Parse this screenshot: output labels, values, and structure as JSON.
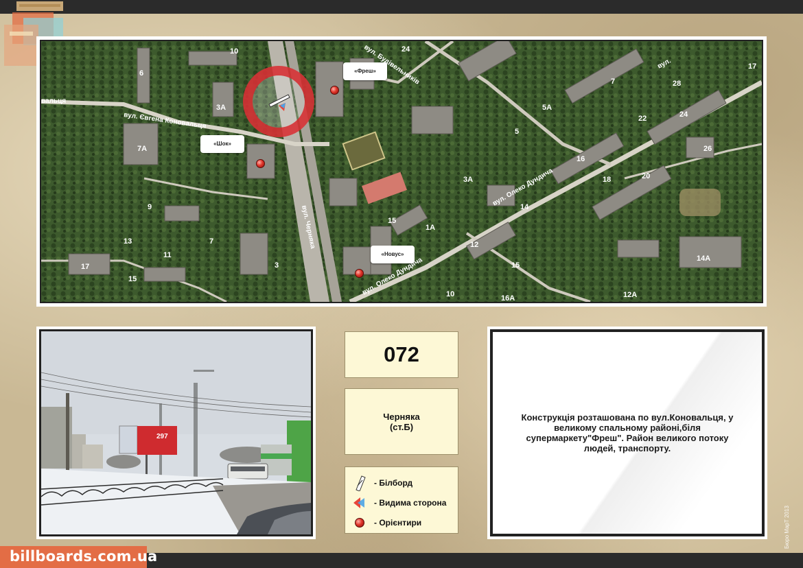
{
  "site": {
    "badge": "billboards.com.ua",
    "copyright": "Бюро МарТ 2013"
  },
  "map": {
    "callouts": [
      {
        "id": "fresh",
        "label": "«Фреш»"
      },
      {
        "id": "shok",
        "label": "«Шок»"
      },
      {
        "id": "novus",
        "label": "«Новус»"
      }
    ],
    "street_labels": [
      "вул. Євгена Коновальця",
      "вул. Черняка",
      "вул. Олеко Дундича",
      "вул. Олеко Дундича",
      "вул.",
      "вул. Будівельників",
      "вальця"
    ],
    "house_numbers": [
      "10",
      "6",
      "3А",
      "24",
      "7",
      "28",
      "17",
      "5А",
      "22",
      "24",
      "26",
      "16",
      "18",
      "20",
      "5",
      "7А",
      "3А",
      "14",
      "15",
      "1А",
      "12",
      "14А",
      "9",
      "13",
      "7",
      "3",
      "11",
      "17",
      "15",
      "10",
      "12А",
      "15",
      "16А"
    ]
  },
  "info": {
    "code": "072",
    "street_line1": "Черняка",
    "street_line2": "(ст.Б)",
    "legend": [
      {
        "icon": "billboard-icon",
        "label": "- Білборд"
      },
      {
        "icon": "visible-side-icon",
        "label": "- Видима сторона"
      },
      {
        "icon": "landmark-icon",
        "label": "- Орієнтири"
      }
    ],
    "description": "Конструкція розташована по вул.Коновальця, у великому спальному районі,біля супермаркету\"Фреш\". Район великого потоку людей, транспорту."
  },
  "photo": {
    "billboard_text": "297"
  },
  "colors": {
    "accent": "#e36d45",
    "ring": "#d7282d",
    "box_bg": "#fdf8d6",
    "dark": "#2b2b2b"
  }
}
